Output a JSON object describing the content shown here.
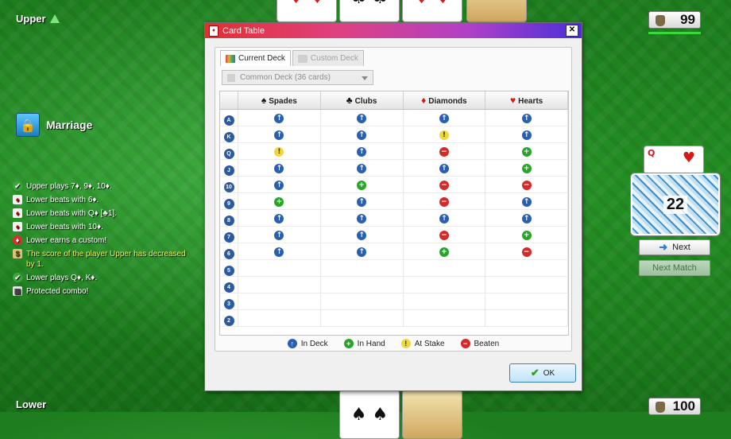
{
  "players": {
    "upper": "Upper",
    "lower": "Lower"
  },
  "scores": {
    "upper": "99",
    "lower": "100"
  },
  "marriage": {
    "title": "Marriage"
  },
  "log": [
    {
      "text": "Upper plays 7♦, 9♦, 10♦.",
      "icon": "check-icon",
      "yellow": false
    },
    {
      "text": "Lower beats with 6♦.",
      "icon": "card-icon",
      "yellow": false
    },
    {
      "text": "Lower beats with Q♦ [♣1].",
      "icon": "card-icon",
      "yellow": false
    },
    {
      "text": "Lower beats with 10♦.",
      "icon": "card-icon",
      "yellow": false
    },
    {
      "text": "Lower earns a custom!",
      "icon": "gem-icon",
      "yellow": false
    },
    {
      "text": "The score of the player Upper has decreased by 1.",
      "icon": "money-bag-icon",
      "yellow": true
    },
    {
      "text": "Lower plays Q♦, K♦.",
      "icon": "check-icon",
      "yellow": false
    },
    {
      "text": "Protected combo!",
      "icon": "combo-icon",
      "yellow": false
    }
  ],
  "side": {
    "trump_rank": "Q",
    "deck_count": "22",
    "next_label": "Next",
    "next_match_label": "Next Match"
  },
  "dialog": {
    "title": "Card Table",
    "tabs": [
      {
        "label": "Current Deck"
      },
      {
        "label": "Custom Deck"
      }
    ],
    "deck_select": "Common Deck (36 cards)",
    "columns": [
      "Spades",
      "Clubs",
      "Diamonds",
      "Hearts"
    ],
    "rows": [
      {
        "rank": "A",
        "cells": [
          "indeck",
          "indeck",
          "indeck",
          "indeck"
        ]
      },
      {
        "rank": "K",
        "cells": [
          "indeck",
          "indeck",
          "stake",
          "indeck"
        ]
      },
      {
        "rank": "Q",
        "cells": [
          "stake",
          "indeck",
          "beaten",
          "inhand"
        ]
      },
      {
        "rank": "J",
        "cells": [
          "indeck",
          "indeck",
          "indeck",
          "inhand"
        ]
      },
      {
        "rank": "10",
        "cells": [
          "indeck",
          "inhand",
          "beaten",
          "beaten"
        ]
      },
      {
        "rank": "9",
        "cells": [
          "inhand",
          "indeck",
          "beaten",
          "indeck"
        ]
      },
      {
        "rank": "8",
        "cells": [
          "indeck",
          "indeck",
          "indeck",
          "indeck"
        ]
      },
      {
        "rank": "7",
        "cells": [
          "indeck",
          "indeck",
          "beaten",
          "inhand"
        ]
      },
      {
        "rank": "6",
        "cells": [
          "indeck",
          "indeck",
          "inhand",
          "beaten"
        ]
      },
      {
        "rank": "5",
        "cells": [
          "",
          "",
          "",
          ""
        ]
      },
      {
        "rank": "4",
        "cells": [
          "",
          "",
          "",
          ""
        ]
      },
      {
        "rank": "3",
        "cells": [
          "",
          "",
          "",
          ""
        ]
      },
      {
        "rank": "2",
        "cells": [
          "",
          "",
          "",
          ""
        ]
      }
    ],
    "legend": {
      "in_deck": "In Deck",
      "in_hand": "In Hand",
      "at_stake": "At Stake",
      "beaten": "Beaten"
    },
    "ok_label": "OK"
  }
}
